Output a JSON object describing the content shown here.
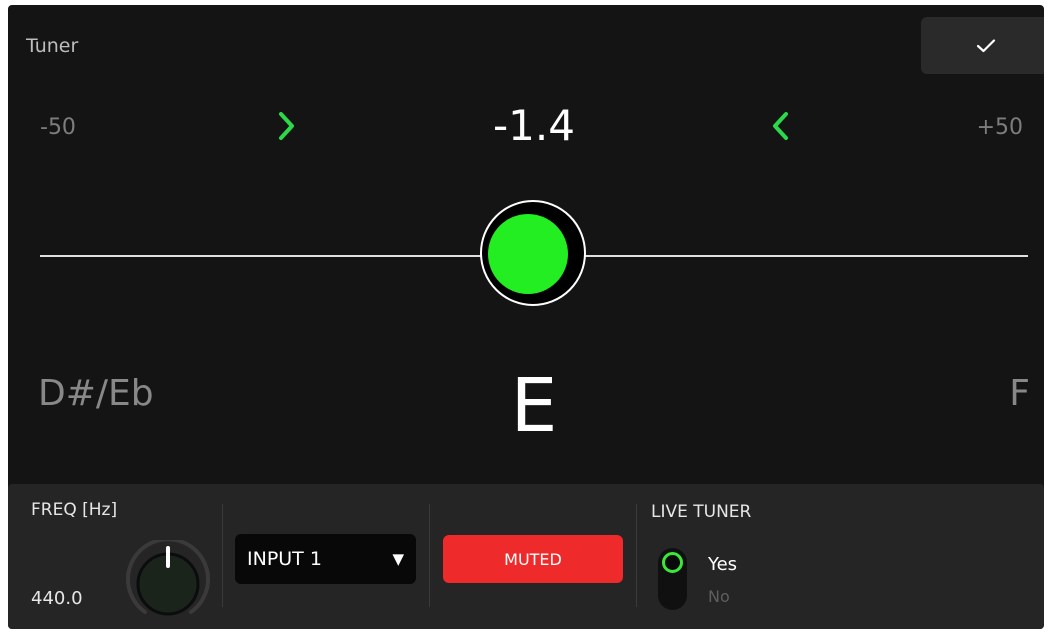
{
  "header": {
    "title": "Tuner",
    "confirm_icon": "check-icon"
  },
  "scale": {
    "min_label": "-50",
    "max_label": "+50",
    "cents_value": "-1.4"
  },
  "notes": {
    "flat_neighbor": "D#/Eb",
    "current": "E",
    "sharp_neighbor": "F"
  },
  "colors": {
    "in_tune": "#22ee22",
    "muted": "#ee2a2a",
    "panel": "#141414"
  },
  "controls": {
    "freq_label": "FREQ [Hz]",
    "freq_value": "440.0",
    "input_select": {
      "selected": "INPUT 1"
    },
    "mute_button": "MUTED",
    "live_tuner": {
      "label": "LIVE TUNER",
      "option_yes": "Yes",
      "option_no": "No"
    }
  }
}
